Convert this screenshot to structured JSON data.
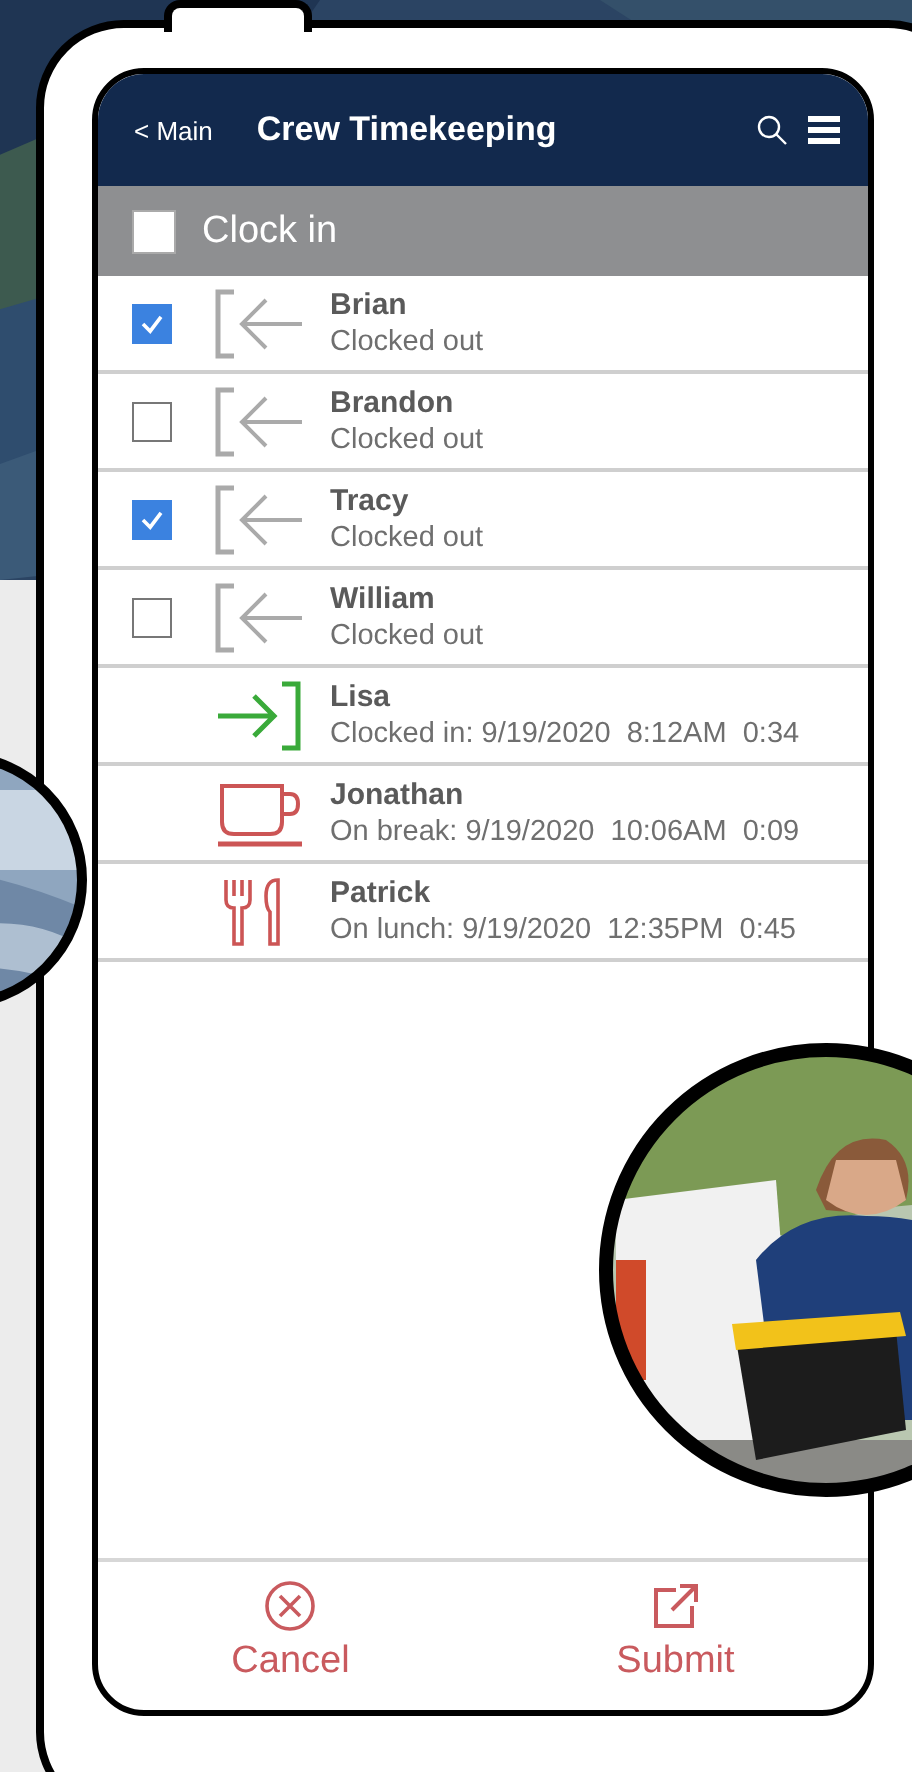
{
  "header": {
    "back": "< Main",
    "title": "Crew Timekeeping"
  },
  "clock_in": {
    "label": "Clock in",
    "checked": false
  },
  "rows": [
    {
      "kind": "out",
      "name": "Brian",
      "status": "Clocked out",
      "checked": true
    },
    {
      "kind": "out",
      "name": "Brandon",
      "status": "Clocked out",
      "checked": false
    },
    {
      "kind": "out",
      "name": "Tracy",
      "status": "Clocked out",
      "checked": true
    },
    {
      "kind": "out",
      "name": "William",
      "status": "Clocked out",
      "checked": false
    },
    {
      "kind": "in",
      "name": "Lisa",
      "status": "Clocked in: 9/19/2020  8:12AM  0:34"
    },
    {
      "kind": "break",
      "name": "Jonathan",
      "status": "On break: 9/19/2020  10:06AM  0:09"
    },
    {
      "kind": "lunch",
      "name": "Patrick",
      "status": "On lunch: 9/19/2020  12:35PM  0:45"
    }
  ],
  "footer": [
    {
      "kind": "cancel",
      "label": "Cancel"
    },
    {
      "kind": "submit",
      "label": "Submit"
    }
  ]
}
